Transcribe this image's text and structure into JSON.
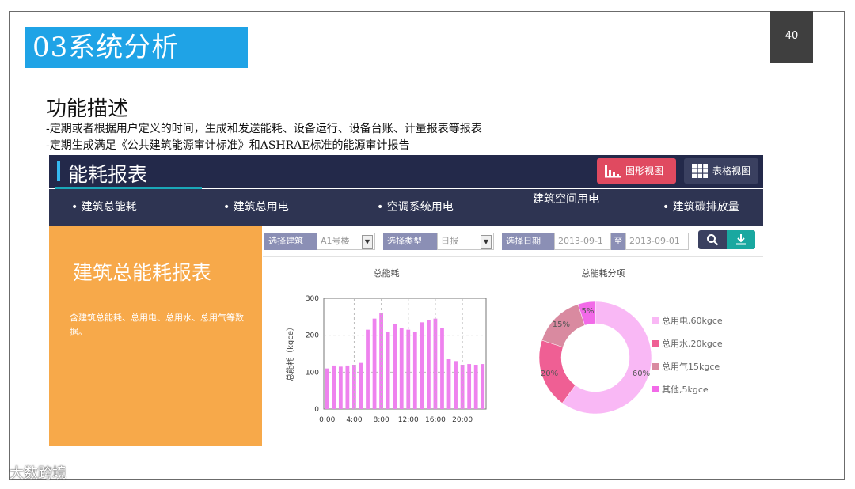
{
  "slide": {
    "title": "03系统分析",
    "page_number": "40",
    "heading": "功能描述",
    "lines": [
      "-定期或者根据用户定义的时间，生成和发送能耗、设备运行、设备台账、计量报表等报表",
      "-定期生成满足《公共建筑能源审计标准》和ASHRAE标准的能源审计报告"
    ],
    "watermark": "大数跨境"
  },
  "app": {
    "title": "能耗报表",
    "btn_chart": "图形视图",
    "btn_table": "表格视图",
    "nav": [
      "• 建筑总能耗",
      "• 建筑总用电",
      "• 空调系统用电",
      "建筑空间用电",
      "• 建筑碳排放量"
    ],
    "side_title": "建筑总能耗报表",
    "side_text": "含建筑总能耗、总用电、总用水、总用气等数据。",
    "filters": {
      "building_label": "选择建筑",
      "building_value": "A1号楼",
      "type_label": "选择类型",
      "type_value": "日报",
      "date_label": "选择日期",
      "date_start": "2013-09-1",
      "date_sep": "至",
      "date_end": "2013-09-01"
    },
    "icons": {
      "chart_btn": "bar-chart-icon",
      "table_btn": "grid-icon",
      "search": "search-icon",
      "download": "download-icon",
      "dropdown": "chevron-down-icon"
    },
    "colors": {
      "header": "#23294a",
      "nav": "#2e3452",
      "accent_red": "#e04a60",
      "side": "#f7a94a",
      "bars": "#ee82ee"
    }
  },
  "chart_data": [
    {
      "type": "bar",
      "title": "总能耗",
      "ylabel": "总能耗（kgce）",
      "xlabel": "",
      "ylim": [
        0,
        300
      ],
      "yticks": [
        "0",
        "100",
        "200",
        "300"
      ],
      "xticks": [
        "0:00",
        "4:00",
        "8:00",
        "12:00",
        "16:00",
        "20:00"
      ],
      "grid": true,
      "values": [
        110,
        118,
        115,
        118,
        120,
        125,
        215,
        245,
        260,
        210,
        230,
        220,
        215,
        210,
        235,
        240,
        245,
        220,
        135,
        130,
        120,
        122,
        120,
        122
      ]
    },
    {
      "type": "pie",
      "title": "总能耗分项",
      "donut": true,
      "legend_position": "right",
      "slices": [
        {
          "label": "总用电,60kgce",
          "value": 60,
          "percent": "60%",
          "color": "#f9b8f5"
        },
        {
          "label": "总用水,20kgce",
          "value": 20,
          "percent": "20%",
          "color": "#ef5f94"
        },
        {
          "label": "总用气15kgce",
          "value": 15,
          "percent": "15%",
          "color": "#d98aa0"
        },
        {
          "label": "其他,5kgce",
          "value": 5,
          "percent": "5%",
          "color": "#f26ae8"
        }
      ]
    }
  ]
}
